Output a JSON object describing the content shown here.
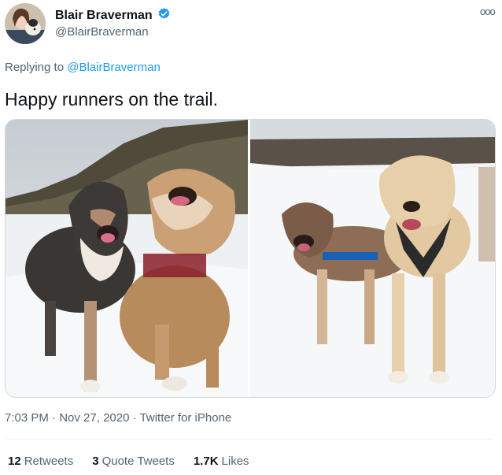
{
  "author": {
    "display_name": "Blair Braverman",
    "handle": "@BlairBraverman",
    "verified_icon": "verified-badge-icon",
    "verified_color": "#1d9bf0"
  },
  "reply": {
    "prefix": "Replying to",
    "target": "@BlairBraverman"
  },
  "tweet": {
    "text": "Happy runners on the trail."
  },
  "meta": {
    "time": "7:03 PM",
    "date": "Nov 27, 2020",
    "source": "Twitter for iPhone",
    "separator": "·"
  },
  "stats": {
    "retweets_count": "12",
    "retweets_label": "Retweets",
    "quotes_count": "3",
    "quotes_label": "Quote Tweets",
    "likes_count": "1.7K",
    "likes_label": "Likes"
  },
  "icons": {
    "more": "more-options-icon",
    "more_glyph": "ooo"
  },
  "colors": {
    "accent": "#1d9bf0",
    "secondary_text": "#536471",
    "primary_text": "#0f1419"
  }
}
